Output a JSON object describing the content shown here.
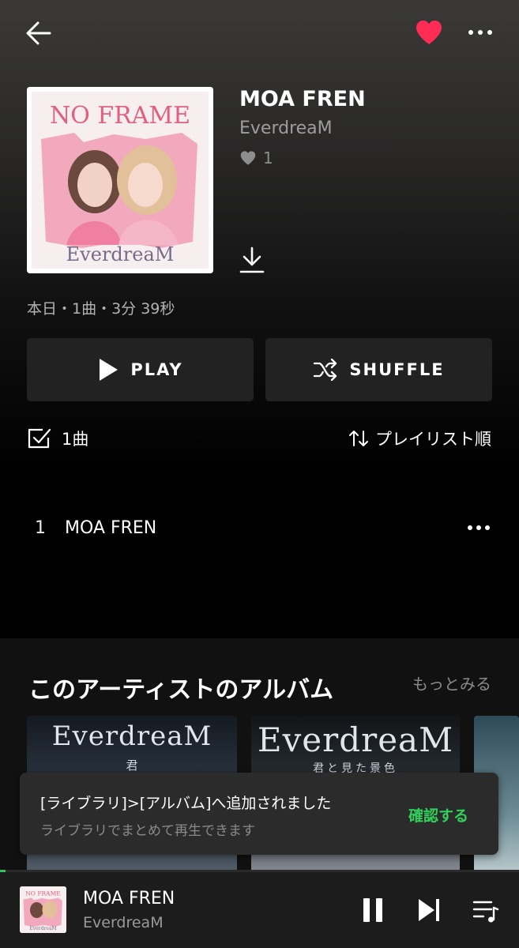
{
  "header": {
    "back_icon": "arrow-left-icon",
    "favorite_icon": "heart-filled-icon",
    "more_icon": "more-horizontal-icon",
    "favorite_color": "#ff2d55"
  },
  "album": {
    "title": "MOA FREN",
    "artist": "EverdreaM",
    "likes": "1",
    "cover_title": "NO FRAME",
    "cover_artist": "EverdreaM",
    "meta": "本日・1曲・3分 39秒"
  },
  "actions": {
    "play_label": "PLAY",
    "shuffle_label": "SHUFFLE"
  },
  "list_controls": {
    "count_label": "1曲",
    "sort_label": "プレイリスト順"
  },
  "tracks": [
    {
      "number": "1",
      "title": "MOA FREN"
    }
  ],
  "artist_albums": {
    "title": "このアーティストのアルバム",
    "see_more": "もっとみる",
    "cards": [
      {
        "logo": "EverdreaM",
        "sub": "君"
      },
      {
        "logo": "EverdreaM",
        "sub": "君と見た景色"
      },
      {
        "logo": "",
        "sub": ""
      }
    ]
  },
  "toast": {
    "message": "[ライブラリ]>[アルバム]へ追加されました",
    "sub": "ライブラリでまとめて再生できます",
    "action": "確認する",
    "action_color": "#2fd15a"
  },
  "now_playing": {
    "title": "MOA FREN",
    "artist": "EverdreaM",
    "progress": 0.01,
    "cover_title": "NO FRAME",
    "cover_artist": "EverdreaM"
  }
}
